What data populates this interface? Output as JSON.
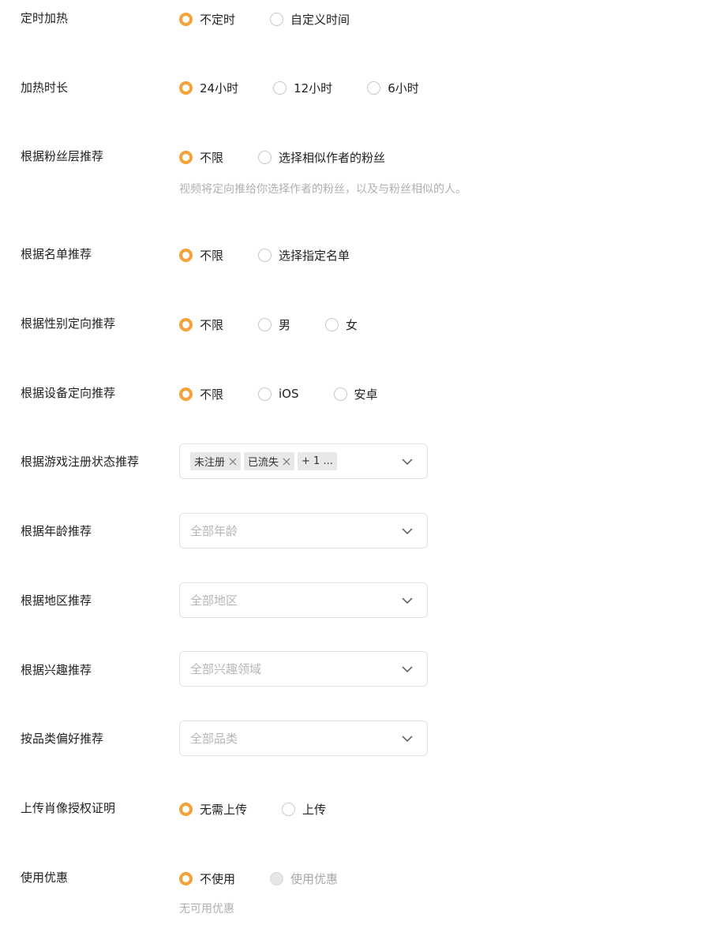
{
  "timed_heating": {
    "label": "定时加热",
    "options": [
      "不定时",
      "自定义时间"
    ]
  },
  "heating_duration": {
    "label": "加热时长",
    "options": [
      "24小时",
      "12小时",
      "6小时"
    ]
  },
  "fan_layer": {
    "label": "根据粉丝层推荐",
    "options": [
      "不限",
      "选择相似作者的粉丝"
    ],
    "hint": "视频将定向推给你选择作者的粉丝，以及与粉丝相似的人。"
  },
  "list_recommend": {
    "label": "根据名单推荐",
    "options": [
      "不限",
      "选择指定名单"
    ]
  },
  "gender": {
    "label": "根据性别定向推荐",
    "options": [
      "不限",
      "男",
      "女"
    ]
  },
  "device": {
    "label": "根据设备定向推荐",
    "options": [
      "不限",
      "iOS",
      "安卓"
    ]
  },
  "game_status": {
    "label": "根据游戏注册状态推荐",
    "tags": [
      "未注册",
      "已流失"
    ],
    "more": "+ 1 ..."
  },
  "age": {
    "label": "根据年龄推荐",
    "placeholder": "全部年龄"
  },
  "region": {
    "label": "根据地区推荐",
    "placeholder": "全部地区"
  },
  "interest": {
    "label": "根据兴趣推荐",
    "placeholder": "全部兴趣领域"
  },
  "category": {
    "label": "按品类偏好推荐",
    "placeholder": "全部品类"
  },
  "portrait": {
    "label": "上传肖像授权证明",
    "options": [
      "无需上传",
      "上传"
    ]
  },
  "coupon": {
    "label": "使用优惠",
    "options": [
      "不使用",
      "使用优惠"
    ],
    "hint": "无可用优惠"
  },
  "colors": {
    "accent": "#f6a23a",
    "border": "#e3e3e3",
    "placeholder": "#b6b6b6"
  },
  "icons": {
    "dropdown": "chevron-down-icon",
    "tag_remove": "close-icon"
  }
}
